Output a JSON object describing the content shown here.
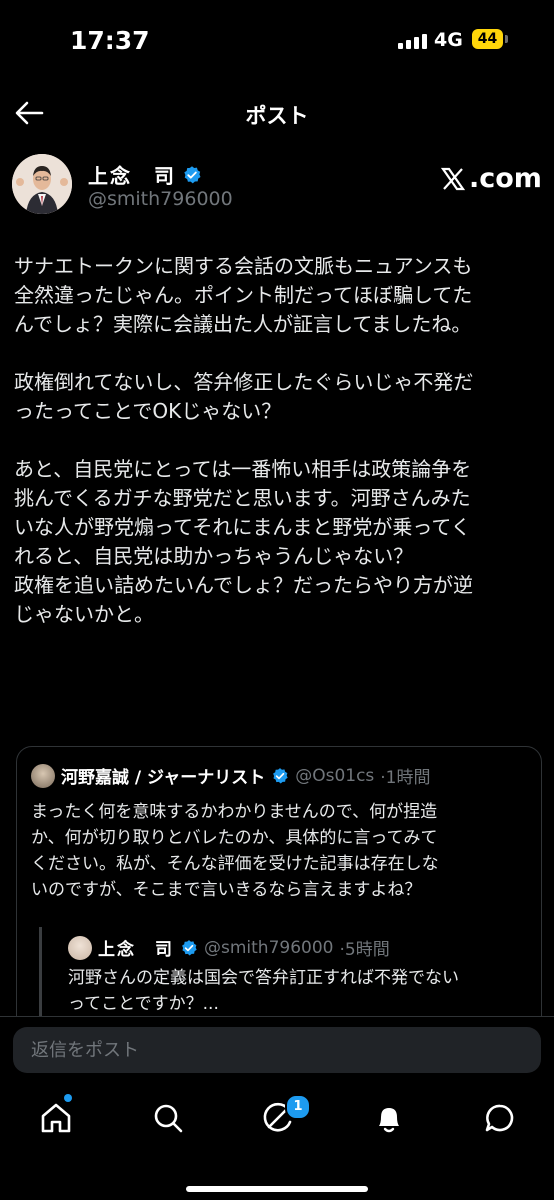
{
  "status": {
    "time": "17:37",
    "network": "4G",
    "battery": "44"
  },
  "header": {
    "title": "ポスト"
  },
  "post": {
    "author_name": "上念　司",
    "handle": "@smith796000",
    "source": "com",
    "paragraphs": [
      "サナエトークンに関する会話の文脈もニュアンスも\n全然違ったじゃん。ポイント制だってほぼ騙してた\nんでしょ？実際に会議出た人が証言してましたね。",
      "政権倒れてないし、答弁修正したぐらいじゃ不発だ\nったってことでOKじゃない？",
      "あと、自民党にとっては一番怖い相手は政策論争を\n挑んでくるガチな野党だと思います。河野さんみた\nいな人が野党煽ってそれにまんまと野党が乗ってく\nれると、自民党は助かっちゃうんじゃない？\n政権を追い詰めたいんでしょ？だったらやり方が逆\nじゃないかと。"
    ]
  },
  "quote": {
    "author_name": "河野嘉誠 / ジャーナリスト",
    "handle": "@Os01cs",
    "time": "·1時間",
    "text": "まったく何を意味するかわかりませんので、何が捏造\nか、何が切り取りとバレたのか、具体的に言ってみて\nください。私が、そんな評価を受けた記事は存在しな\nいのですが、そこまで言いきるなら言えますよね？",
    "nested": {
      "author_name": "上念　司",
      "handle": "@smith796000",
      "time": "·5時間",
      "text": "河野さんの定義は国会で答弁訂正すれば不発でない\nってことですか？..."
    }
  },
  "reply": {
    "placeholder": "返信をポスト"
  },
  "tabs": {
    "messages_badge": "1",
    "icons": [
      "home-icon",
      "search-icon",
      "grok-icon",
      "bell-icon",
      "messages-icon"
    ]
  },
  "colors": {
    "accent": "#1d9bf0",
    "background": "#000000",
    "muted": "#71767b"
  }
}
